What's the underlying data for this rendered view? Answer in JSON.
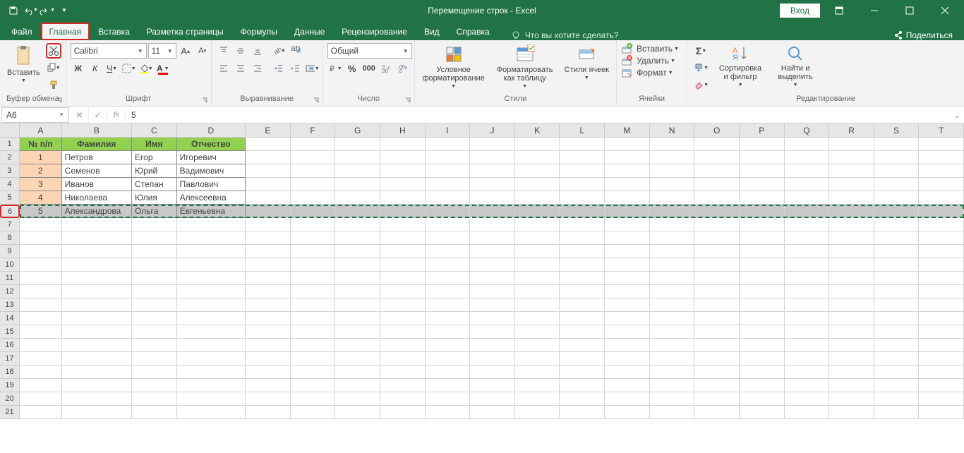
{
  "title": "Перемещение строк  -  Excel",
  "login": "Вход",
  "tabs": [
    "Файл",
    "Главная",
    "Вставка",
    "Разметка страницы",
    "Формулы",
    "Данные",
    "Рецензирование",
    "Вид",
    "Справка"
  ],
  "tellme": "Что вы хотите сделать?",
  "share": "Поделиться",
  "ribbon": {
    "clipboard": {
      "label": "Буфер обмена",
      "paste": "Вставить"
    },
    "font": {
      "label": "Шрифт",
      "name": "Calibri",
      "size": "11"
    },
    "alignment": {
      "label": "Выравнивание"
    },
    "number": {
      "label": "Число",
      "format": "Общий"
    },
    "styles": {
      "label": "Стили",
      "cond": "Условное форматирование",
      "table": "Форматировать как таблицу",
      "cell": "Стили ячеек"
    },
    "cells": {
      "label": "Ячейки",
      "insert": "Вставить",
      "delete": "Удалить",
      "format": "Формат"
    },
    "editing": {
      "label": "Редактирование",
      "sort": "Сортировка и фильтр",
      "find": "Найти и выделить"
    }
  },
  "namebox": "A6",
  "formula": "5",
  "columns": [
    "A",
    "B",
    "C",
    "D",
    "E",
    "F",
    "G",
    "H",
    "I",
    "J",
    "K",
    "L",
    "M",
    "N",
    "O",
    "P",
    "Q",
    "R",
    "S",
    "T"
  ],
  "rownums": [
    "1",
    "2",
    "3",
    "4",
    "5",
    "6",
    "7",
    "8",
    "9",
    "10",
    "11",
    "12",
    "13",
    "14",
    "15",
    "16",
    "17",
    "18",
    "19",
    "20",
    "21"
  ],
  "headers": {
    "a": "№ п/п",
    "b": "Фамилия",
    "c": "Имя",
    "d": "Отчество"
  },
  "data": [
    {
      "n": "1",
      "f": "Петров",
      "i": "Егор",
      "o": "Игоревич"
    },
    {
      "n": "2",
      "f": "Семенов",
      "i": "Юрий",
      "o": "Вадимович"
    },
    {
      "n": "3",
      "f": "Иванов",
      "i": "Степан",
      "o": "Павлович"
    },
    {
      "n": "4",
      "f": "Николаева",
      "i": "Юлия",
      "o": "Алексеевна"
    },
    {
      "n": "5",
      "f": "Александрова",
      "i": "Ольга",
      "o": "Евгеньевна"
    }
  ]
}
